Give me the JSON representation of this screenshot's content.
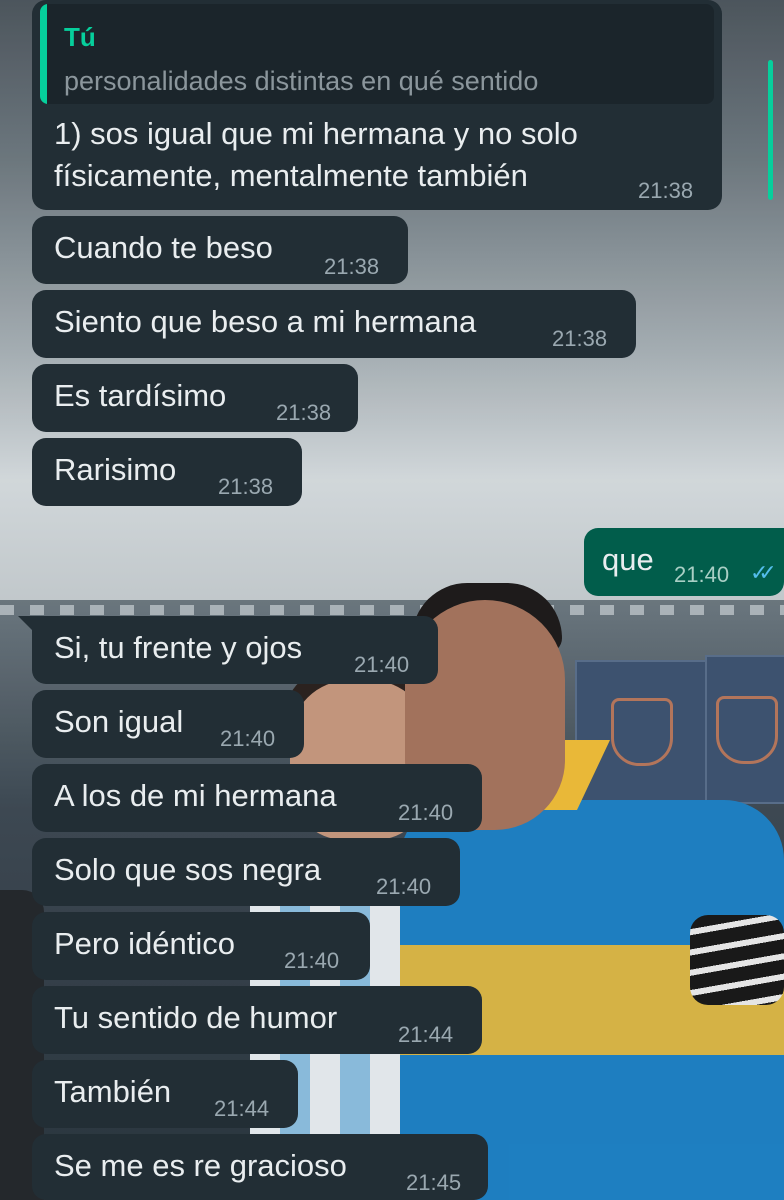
{
  "quoted_reply": {
    "author": "Tú",
    "text": "personalidades distintas en qué sentido"
  },
  "messages": [
    {
      "dir": "in",
      "lines": [
        "1) sos igual que mi hermana y no solo",
        "físicamente, mentalmente también"
      ],
      "time": "21:38"
    },
    {
      "dir": "in",
      "text": "Cuando te beso",
      "time": "21:38"
    },
    {
      "dir": "in",
      "text": "Siento que beso a mi hermana",
      "time": "21:38"
    },
    {
      "dir": "in",
      "text": "Es tardísimo",
      "time": "21:38"
    },
    {
      "dir": "in",
      "text": "Rarisimo",
      "time": "21:38"
    },
    {
      "dir": "out",
      "text": "que",
      "time": "21:40",
      "status_icon": "double-check-read-icon"
    },
    {
      "dir": "in",
      "text": "Si, tu frente y ojos",
      "time": "21:40"
    },
    {
      "dir": "in",
      "text": "Son igual",
      "time": "21:40"
    },
    {
      "dir": "in",
      "text": "A los de mi hermana",
      "time": "21:40"
    },
    {
      "dir": "in",
      "text": "Solo que sos negra",
      "time": "21:40"
    },
    {
      "dir": "in",
      "text": "Pero idéntico",
      "time": "21:40"
    },
    {
      "dir": "in",
      "text": "Tu sentido de humor",
      "time": "21:44"
    },
    {
      "dir": "in",
      "text": "También",
      "time": "21:44"
    },
    {
      "dir": "in",
      "text": "Se me es re gracioso",
      "time": "21:45"
    }
  ],
  "colors": {
    "incoming_bubble": "#222e35",
    "outgoing_bubble": "#015d4b",
    "accent": "#06cf9c",
    "read_ticks": "#53bdeb"
  }
}
